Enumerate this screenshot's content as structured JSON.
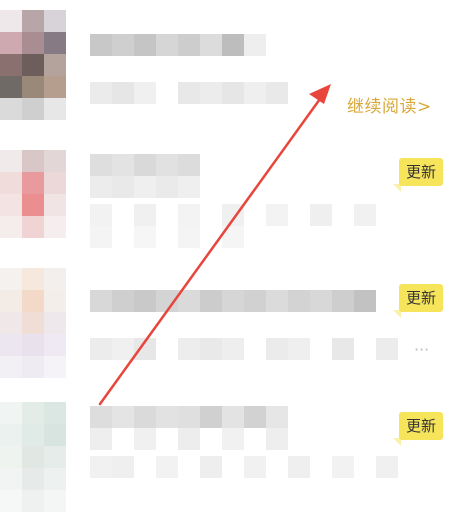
{
  "list": {
    "items": [
      {
        "action_label": "继续阅读>"
      },
      {
        "badge_label": "更新"
      },
      {
        "badge_label": "更新"
      },
      {
        "badge_label": "更新"
      }
    ],
    "ellipsis": "···"
  },
  "colors": {
    "continue_link": "#d8a93a",
    "badge_bg": "#f6e45a",
    "arrow": "#e8463c"
  }
}
